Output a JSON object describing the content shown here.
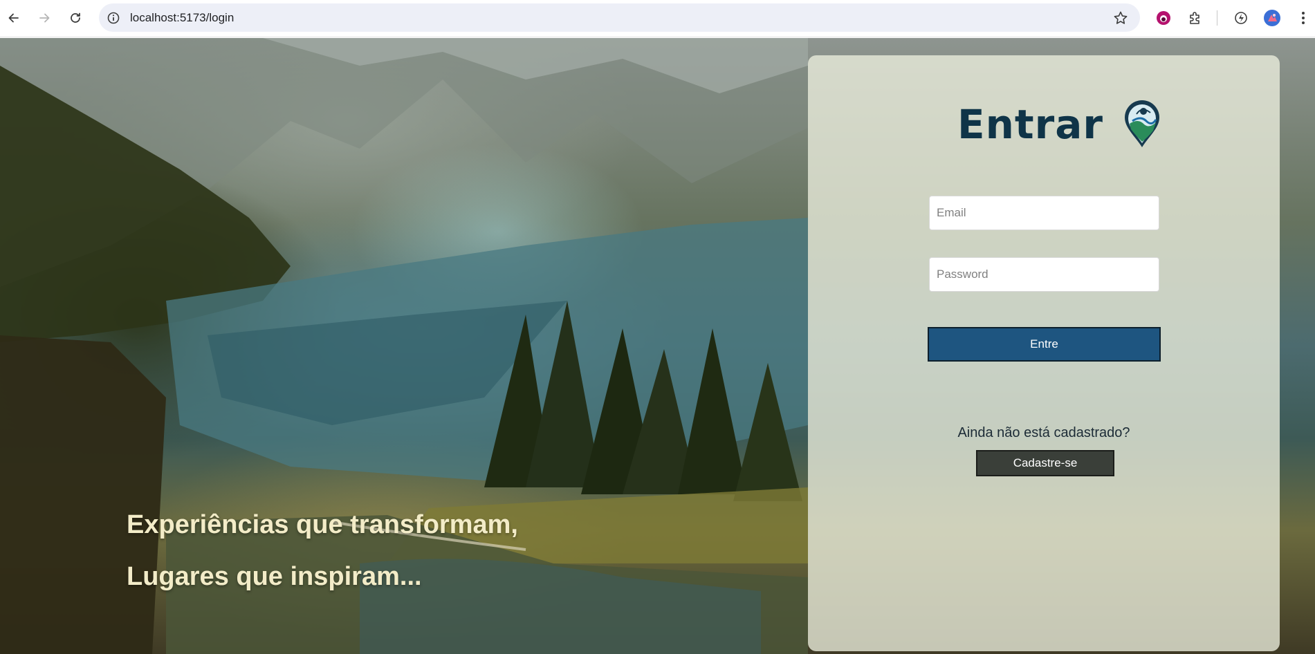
{
  "browser": {
    "url": "localhost:5173/login"
  },
  "hero": {
    "line1": "Experiências que transformam,",
    "line2": "Lugares que inspiram..."
  },
  "login": {
    "title": "Entrar",
    "email_placeholder": "Email",
    "password_placeholder": "Password",
    "submit_label": "Entre",
    "signup_prompt": "Ainda não está cadastrado?",
    "signup_label": "Cadastre-se"
  },
  "colors": {
    "primary_button": "#1e5580",
    "secondary_button": "#3a3f39",
    "title": "#0f3448"
  },
  "icons": [
    "back-icon",
    "forward-icon",
    "reload-icon",
    "site-info-icon",
    "bookmark-star-icon",
    "extension-app-icon",
    "puzzle-extensions-icon",
    "performance-icon",
    "profile-avatar",
    "kebab-menu-icon",
    "map-pin-logo"
  ]
}
